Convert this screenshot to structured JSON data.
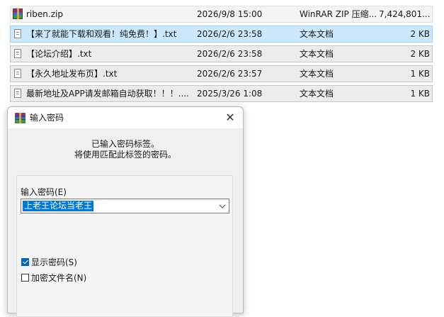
{
  "files": [
    {
      "icon": "winrar-archive-icon",
      "name": "riben.zip",
      "date": "2026/9/8 15:00",
      "type": "WinRAR ZIP 压缩...",
      "size": "7,424,801...",
      "state": "normal"
    },
    {
      "icon": "text-file-icon",
      "name": "【来了就能下载和观看！纯免费！】.txt",
      "date": "2026/2/6 23:58",
      "type": "文本文档",
      "size": "2 KB",
      "state": "selected"
    },
    {
      "icon": "text-file-icon",
      "name": "【论坛介绍】.txt",
      "date": "2026/2/6 23:58",
      "type": "文本文档",
      "size": "2 KB",
      "state": "boxed"
    },
    {
      "icon": "text-file-icon",
      "name": "【永久地址发布页】.txt",
      "date": "2026/2/6 23:57",
      "type": "文本文档",
      "size": "1 KB",
      "state": "boxed"
    },
    {
      "icon": "text-file-icon",
      "name": "最新地址及APP请发邮箱自动获取！！！....",
      "date": "2025/3/26 1:08",
      "type": "文本文档",
      "size": "1 KB",
      "state": "boxed"
    }
  ],
  "dialog": {
    "title": "输入密码",
    "close_glyph": "✕",
    "message_line1": "已输入密码标签。",
    "message_line2": "将使用匹配此标签的密码。",
    "password_label": "输入密码(E)",
    "password_value": "上老王论坛当老王",
    "show_password_label": "显示密码(S)",
    "show_password_checked": true,
    "encrypt_names_label": "加密文件名(N)",
    "encrypt_names_checked": false
  },
  "colors": {
    "selection": "#cce8ff",
    "accent": "#0078d7"
  }
}
